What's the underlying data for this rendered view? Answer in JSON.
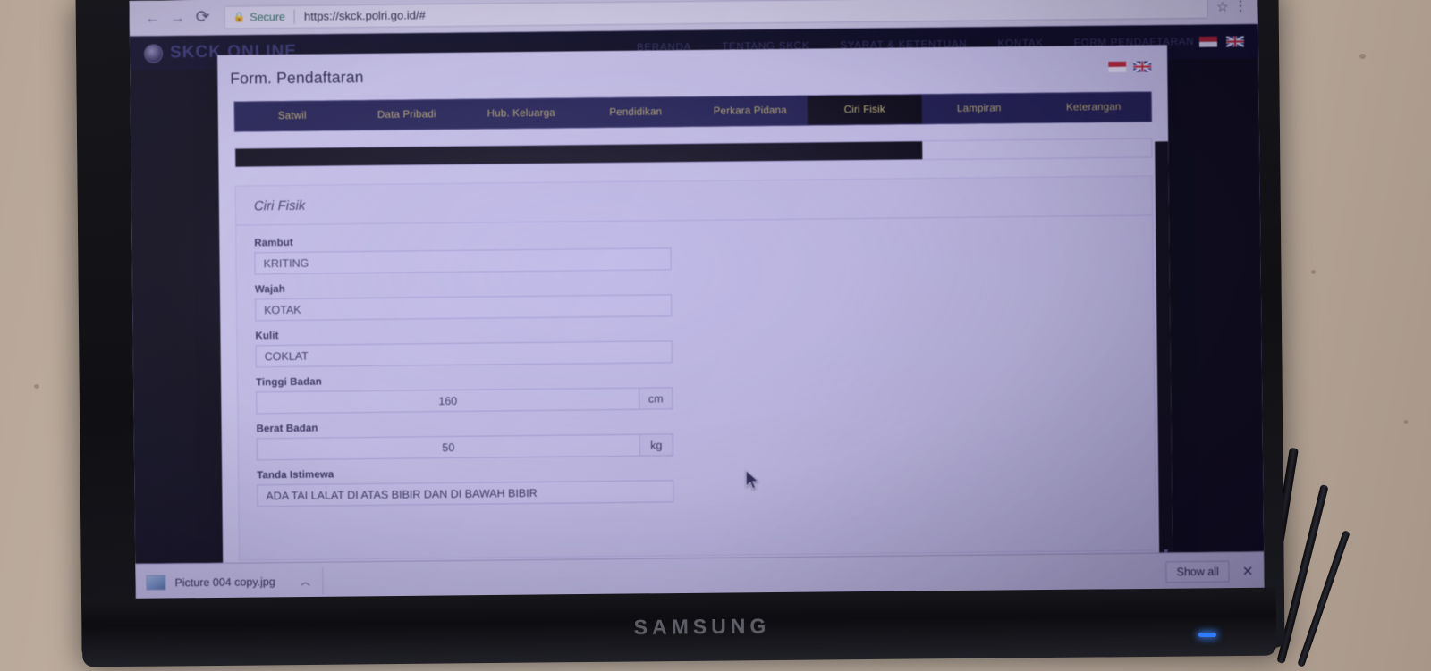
{
  "browser": {
    "back_icon": "back-arrow-icon",
    "forward_icon": "forward-arrow-icon",
    "reload_icon": "reload-icon",
    "security_label": "Secure",
    "lock_icon": "lock-icon",
    "url": "https://skck.polri.go.id/#",
    "bookmark_icon": "star-icon",
    "menu_icon": "kebab-menu-icon"
  },
  "site": {
    "logo_text": "SKCK ONLINE",
    "emblem_icon": "polri-emblem-icon",
    "nav": [
      {
        "label": "BERANDA"
      },
      {
        "label": "TENTANG SKCK"
      },
      {
        "label": "SYARAT & KETENTUAN"
      },
      {
        "label": "KONTAK"
      },
      {
        "label": "FORM PENDAFTARAN"
      }
    ],
    "flags": [
      {
        "name": "indonesia-flag-icon"
      },
      {
        "name": "united-kingdom-flag-icon"
      }
    ]
  },
  "modal": {
    "title": "Form. Pendaftaran",
    "flags": [
      {
        "name": "indonesia-flag-icon"
      },
      {
        "name": "united-kingdom-flag-icon"
      }
    ],
    "tabs": [
      {
        "label": "Satwil",
        "active": false
      },
      {
        "label": "Data Pribadi",
        "active": false
      },
      {
        "label": "Hub. Keluarga",
        "active": false
      },
      {
        "label": "Pendidikan",
        "active": false
      },
      {
        "label": "Perkara Pidana",
        "active": false
      },
      {
        "label": "Ciri Fisik",
        "active": true
      },
      {
        "label": "Lampiran",
        "active": false
      },
      {
        "label": "Keterangan",
        "active": false
      }
    ],
    "progress_percent": 75,
    "panel_title": "Ciri Fisik",
    "fields": [
      {
        "label": "Rambut",
        "value": "KRITING",
        "unit": ""
      },
      {
        "label": "Wajah",
        "value": "KOTAK",
        "unit": ""
      },
      {
        "label": "Kulit",
        "value": "COKLAT",
        "unit": ""
      },
      {
        "label": "Tinggi Badan",
        "value": "160",
        "unit": "cm"
      },
      {
        "label": "Berat Badan",
        "value": "50",
        "unit": "kg"
      },
      {
        "label": "Tanda Istimewa",
        "value": "ADA TAI LALAT DI ATAS BIBIR DAN DI BAWAH BIBIR",
        "unit": ""
      }
    ],
    "scrollbar_arrow": "▼"
  },
  "downloads": {
    "file_name": "Picture 004 copy.jpg",
    "file_thumb_icon": "image-file-icon",
    "caret_icon": "chevron-up-icon",
    "show_all_label": "Show all",
    "close_icon": "close-icon"
  },
  "hardware": {
    "monitor_brand": "SAMSUNG"
  },
  "colors": {
    "screen_bg": "#ada4e8",
    "modal_bg": "#cdc7ec",
    "tab_bar": "#1c1a4a",
    "tab_active": "#08060f",
    "tab_text": "#b8a96b",
    "progress_fill": "#08060f",
    "led": "#2f7bff"
  }
}
